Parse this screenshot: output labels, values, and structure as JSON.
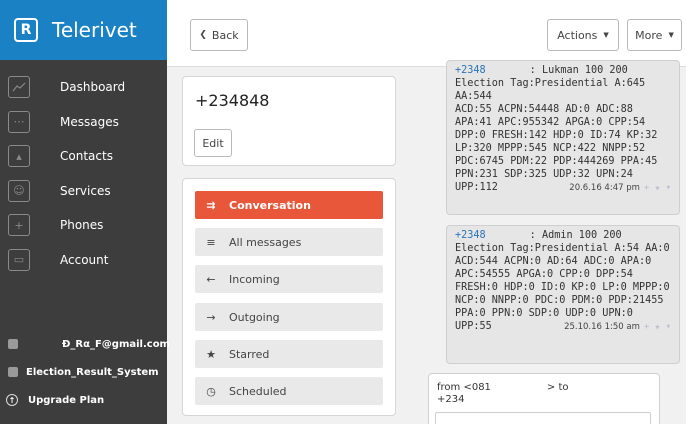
{
  "brand": {
    "name": "Telerivet",
    "logo_glyph": "R"
  },
  "sidebar": {
    "items": [
      {
        "label": "Dashboard",
        "icon": "chart-icon"
      },
      {
        "label": "Messages",
        "icon": "chat-icon"
      },
      {
        "label": "Contacts",
        "icon": "contact-icon"
      },
      {
        "label": "Services",
        "icon": "robot-icon"
      },
      {
        "label": "Phones",
        "icon": "phone-icon"
      },
      {
        "label": "Account",
        "icon": "briefcase-icon"
      }
    ],
    "email": "Ð_Rα_F@gmail.com",
    "project": "Election_Result_System",
    "upgrade": "Upgrade Plan"
  },
  "toolbar": {
    "back_label": "Back",
    "actions_label": "Actions",
    "more_label": "More"
  },
  "contact": {
    "phone": "+234848",
    "edit_label": "Edit"
  },
  "filters": [
    {
      "label": "Conversation",
      "icon": "conversation-icon",
      "glyph": "⇉",
      "active": true
    },
    {
      "label": "All messages",
      "icon": "list-icon",
      "glyph": "≡",
      "active": false
    },
    {
      "label": "Incoming",
      "icon": "arrow-left-icon",
      "glyph": "←",
      "active": false
    },
    {
      "label": "Outgoing",
      "icon": "arrow-right-icon",
      "glyph": "→",
      "active": false
    },
    {
      "label": "Starred",
      "icon": "star-icon",
      "glyph": "★",
      "active": false
    },
    {
      "label": "Scheduled",
      "icon": "clock-icon",
      "glyph": "◷",
      "active": false
    }
  ],
  "messages": [
    {
      "from": "+2348",
      "header_rest": ": Lukman 100 200",
      "lines": [
        "Election Tag:Presidential A:645 AA:544",
        "ACD:55 ACPN:54448 AD:0 ADC:88",
        "APA:41 APC:955342 APGA:0 CPP:54",
        "DPP:0 FRESH:142 HDP:0 ID:74 KP:32",
        "LP:320 MPPP:545 NCP:422 NNPP:52",
        "PDC:6745 PDM:22 PDP:444269 PPA:45",
        "PPN:231 SDP:325 UDP:32 UPN:24"
      ],
      "last_line": "UPP:112",
      "time": "20.6.16 4:47 pm"
    },
    {
      "from": "+2348",
      "header_rest": ": Admin 100 200",
      "lines": [
        "Election Tag:Presidential A:54 AA:0",
        "ACD:544 ACPN:0 AD:64 ADC:0 APA:0",
        "APC:54555 APGA:0 CPP:0 DPP:54",
        "FRESH:0 HDP:0 ID:0 KP:0 LP:0 MPPP:0",
        "NCP:0 NNPP:0 PDC:0 PDM:0 PDP:21455",
        "PPA:0 PPN:0 SDP:0 UDP:0 UPN:0"
      ],
      "last_line": "UPP:55",
      "time": "25.10.16 1:50 am"
    }
  ],
  "compose": {
    "from_label": "from <081",
    "to_label": "> to",
    "to_number": "+234"
  }
}
